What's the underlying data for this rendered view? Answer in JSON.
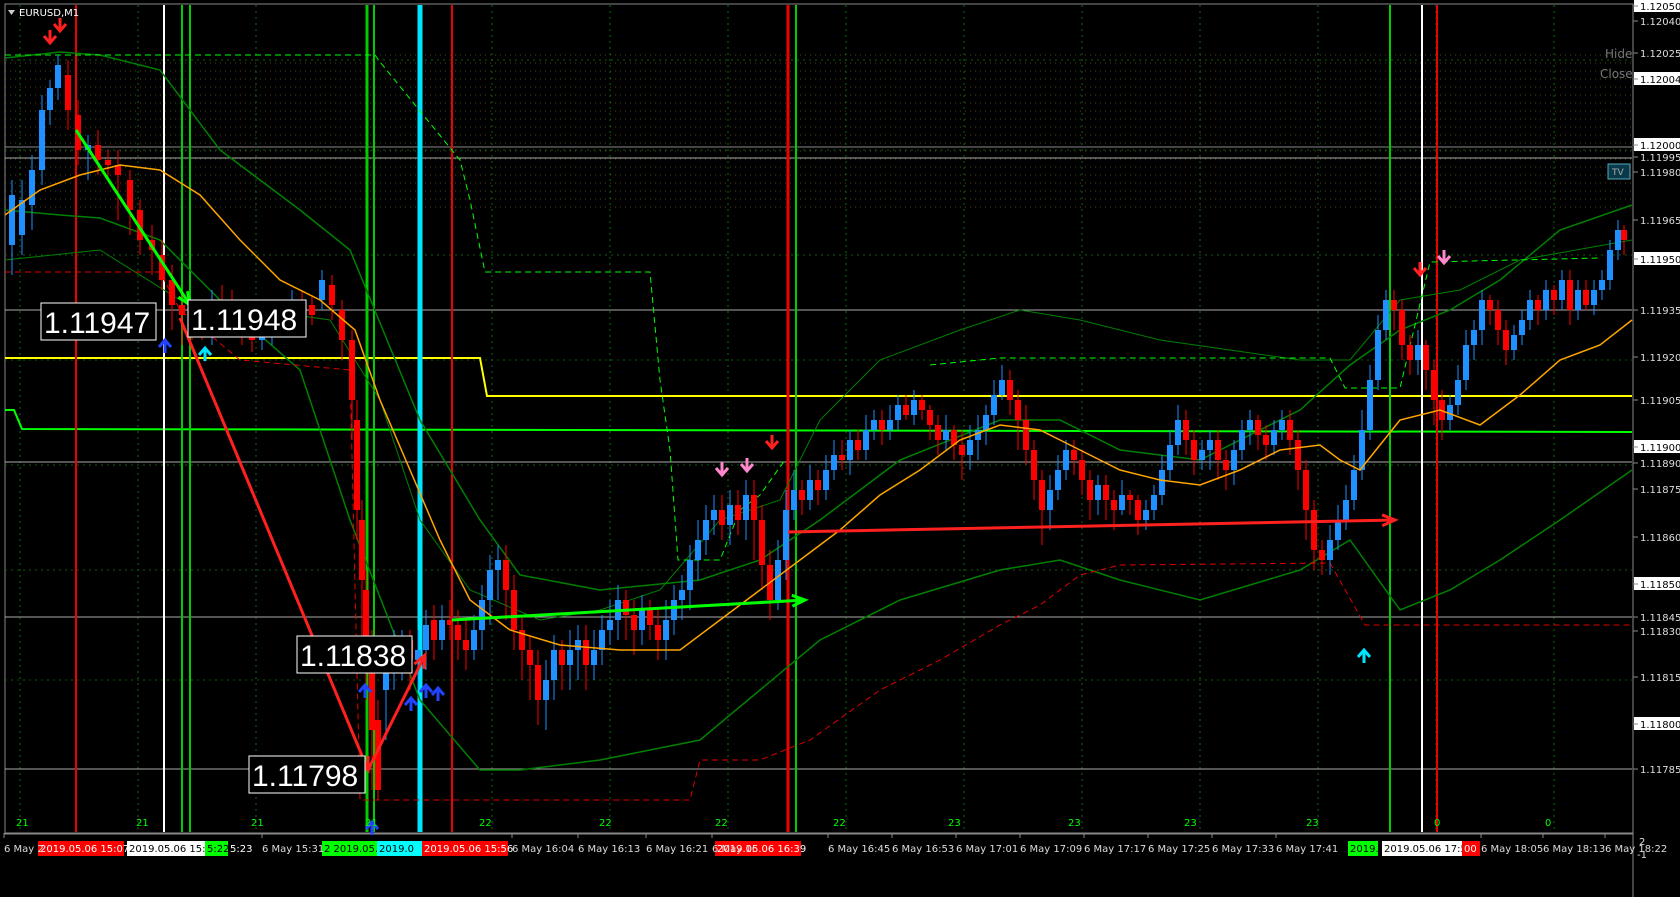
{
  "window": {
    "title": "EURUSD,M1",
    "menu_icon": "triangle-down-icon"
  },
  "overlay_buttons": {
    "hide": "Hide",
    "close": "Close",
    "tv": "TV"
  },
  "price_axis": {
    "ticks": [
      "1.12050",
      "1.12040",
      "1.12025",
      "1.12004",
      "1.12000",
      "1.11995",
      "1.11980",
      "1.11965",
      "1.11950",
      "1.11935",
      "1.11920",
      "1.11905",
      "1.11900",
      "1.11890",
      "1.11875",
      "1.11860",
      "1.11850",
      "1.11845",
      "1.11830",
      "1.11815",
      "1.11800",
      "1.11785"
    ],
    "highlighted": [
      "1.12050",
      "1.12004",
      "1.12000",
      "1.11950",
      "1.11900",
      "1.11850",
      "1.11800"
    ]
  },
  "time_axis": {
    "labels": [
      "6 May 2",
      "6 May 15:31",
      "6 May 16:04",
      "6 May 16:13",
      "6 May 16:21",
      "6 May 16",
      "6 May 16:45",
      "6 May 16:53",
      "6 May 17:01",
      "6 May 17:09",
      "6 May 17:17",
      "6 May 17:25",
      "6 May 17:33",
      "6 May 17:41",
      "6 May 18:05",
      "6 May 18:13",
      "6 May 18:22"
    ],
    "tags": [
      {
        "text": "2019.05.06 15:07",
        "bg": "#ff0000"
      },
      {
        "text": "2019.05.06 15:19",
        "bg": "#ffffff"
      },
      {
        "text": "5:22",
        "bg": "#00ff00"
      },
      {
        "text": "5:23",
        "bg": "#000000"
      },
      {
        "text": "2 2019.05.06",
        "bg": "#00ff00"
      },
      {
        "text": "2019.0",
        "bg": "#00ffff"
      },
      {
        "text": "2019.05.06 15:56",
        "bg": "#ff0000"
      },
      {
        "text": "2019.05.06 16:39",
        "bg": "#ff0000"
      },
      {
        "text": "2019.0",
        "bg": "#00ff00"
      },
      {
        "text": "2019.05.06 17:58",
        "bg": "#ffffff"
      },
      {
        "text": "00",
        "bg": "#ff0000"
      }
    ],
    "cycle_labels": [
      "21",
      "21",
      "21",
      "21",
      "22",
      "22",
      "22",
      "22",
      "23",
      "23",
      "23",
      "23",
      "0",
      "0"
    ],
    "corner": {
      "top": "2",
      "bottom": "-1"
    }
  },
  "price_labels": {
    "p1": "1.11947",
    "p2": "1.11948",
    "p3": "1.11838",
    "p4": "1.11798"
  },
  "colors": {
    "bull": "#1e90ff",
    "bear": "#ff0000",
    "ma": "#ffa500",
    "bands": "#008000",
    "yellow": "#ffff00",
    "green": "#00ff00",
    "cyan": "#00e5ff",
    "pink": "#ff88cc"
  }
}
